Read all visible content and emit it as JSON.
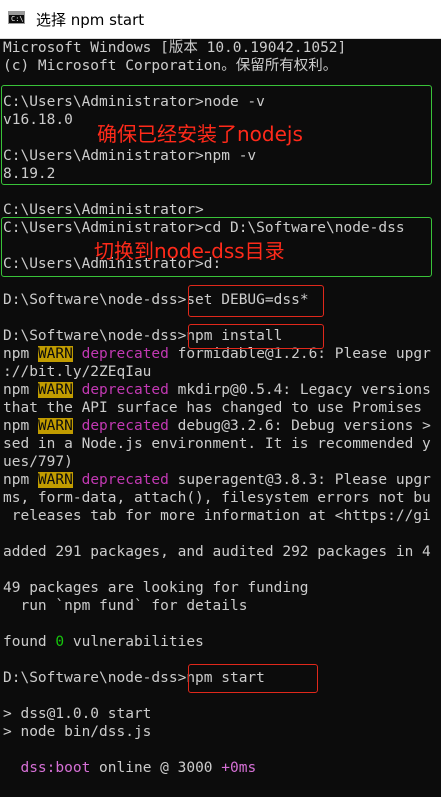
{
  "window": {
    "title": "选择 npm start",
    "icon": "console-app-icon"
  },
  "annotations": {
    "node_note": "确保已经安装了nodejs",
    "dir_note": "切换到node-dss目录",
    "red": "#ff2a1a",
    "green_box": "#39c339",
    "red_box": "#e0281b"
  },
  "console": {
    "l01": "Microsoft Windows [版本 10.0.19042.1052]",
    "l02": "(c) Microsoft Corporation。保留所有权利。",
    "l03": "C:\\Users\\Administrator>node -v",
    "l04": "v16.18.0",
    "l05": "C:\\Users\\Administrator>npm -v",
    "l06": "8.19.2",
    "l07": "C:\\Users\\Administrator>",
    "l08": "C:\\Users\\Administrator>cd D:\\Software\\node-dss",
    "l09": "C:\\Users\\Administrator>d:",
    "l10_prompt": "D:\\Software\\node-dss>",
    "l10_cmd": "set DEBUG=dss*",
    "l11_prompt": "D:\\Software\\node-dss>",
    "l11_cmd": "npm install",
    "npm": "npm",
    "warn": "WARN",
    "deprecated": "deprecated",
    "l12_rest": " formidable@1.2.6: Please upgr",
    "l13": "://bit.ly/2ZEqIau",
    "l14_rest": " mkdirp@0.5.4: Legacy versions",
    "l15": "that the API surface has changed to use Promises",
    "l16_rest": " debug@3.2.6: Debug versions >",
    "l17": "sed in a Node.js environment. It is recommended y",
    "l18": "ues/797)",
    "l19_rest": " superagent@3.8.3: Please upgr",
    "l20": "ms, form-data, attach(), filesystem errors not bu",
    "l21": " releases tab for more information at <https://gi",
    "l22": "added 291 packages, and audited 292 packages in 4",
    "l23": "49 packages are looking for funding",
    "l24": "  run `npm fund` for details",
    "l25_a": "found ",
    "l25_zero": "0",
    "l25_b": " vulnerabilities",
    "l26_prompt": "D:\\Software\\node-dss>",
    "l26_cmd": "npm start",
    "l27": "> dss@1.0.0 start",
    "l28": "> node bin/dss.js",
    "l29_name": "dss:boot",
    "l29_mid": " online @ 3000 ",
    "l29_time": "+0ms"
  }
}
